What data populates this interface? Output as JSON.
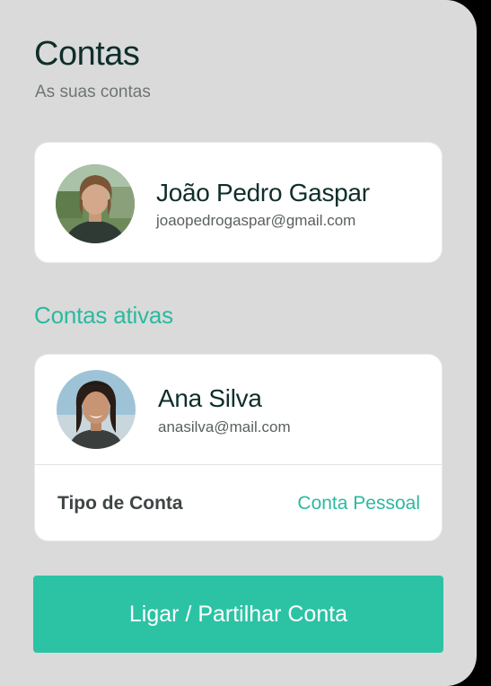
{
  "header": {
    "title": "Contas",
    "subtitle": "As suas contas"
  },
  "main_account": {
    "name": "João Pedro Gaspar",
    "email": "joaopedrogaspar@gmail.com",
    "avatar": "avatar-photo"
  },
  "active_section": {
    "heading": "Contas ativas",
    "accounts": [
      {
        "name": "Ana Silva",
        "email": "anasilva@mail.com",
        "avatar": "avatar-photo",
        "type_label": "Tipo de Conta",
        "type_value": "Conta Pessoal"
      }
    ]
  },
  "cta": {
    "label": "Ligar / Partilhar Conta"
  },
  "colors": {
    "panel_background": "#dadada",
    "accent": "#2cb9a0",
    "button": "#2cc3a5",
    "title": "#0f2e2a"
  }
}
